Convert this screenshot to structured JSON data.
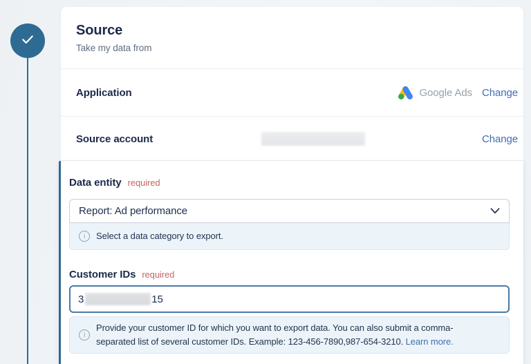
{
  "colors": {
    "accent_blue": "#31688f",
    "link_blue": "#3f6eae",
    "required_red": "#c4655f",
    "info_bg": "#ecf4f9",
    "google_blue": "#4285f4",
    "google_yellow": "#fbbc04",
    "google_green": "#34a853"
  },
  "stepper": {
    "state": "completed"
  },
  "card": {
    "title": "Source",
    "subtitle": "Take my data from",
    "rows": {
      "application": {
        "label": "Application",
        "value": "Google Ads",
        "action": "Change"
      },
      "source_account": {
        "label": "Source account",
        "action": "Change"
      }
    }
  },
  "form": {
    "data_entity": {
      "label": "Data entity",
      "required": "required",
      "value": "Report: Ad performance",
      "help": "Select a data category to export."
    },
    "customer_ids": {
      "label": "Customer IDs",
      "required": "required",
      "value_start": "3",
      "value_end": "15",
      "help_line1": "Provide your customer ID for which you want to export data. You can also submit a comma-",
      "help_line2": "separated list of several customer IDs. Example: 123-456-7890,987-654-3210.",
      "link": "Learn more."
    }
  }
}
